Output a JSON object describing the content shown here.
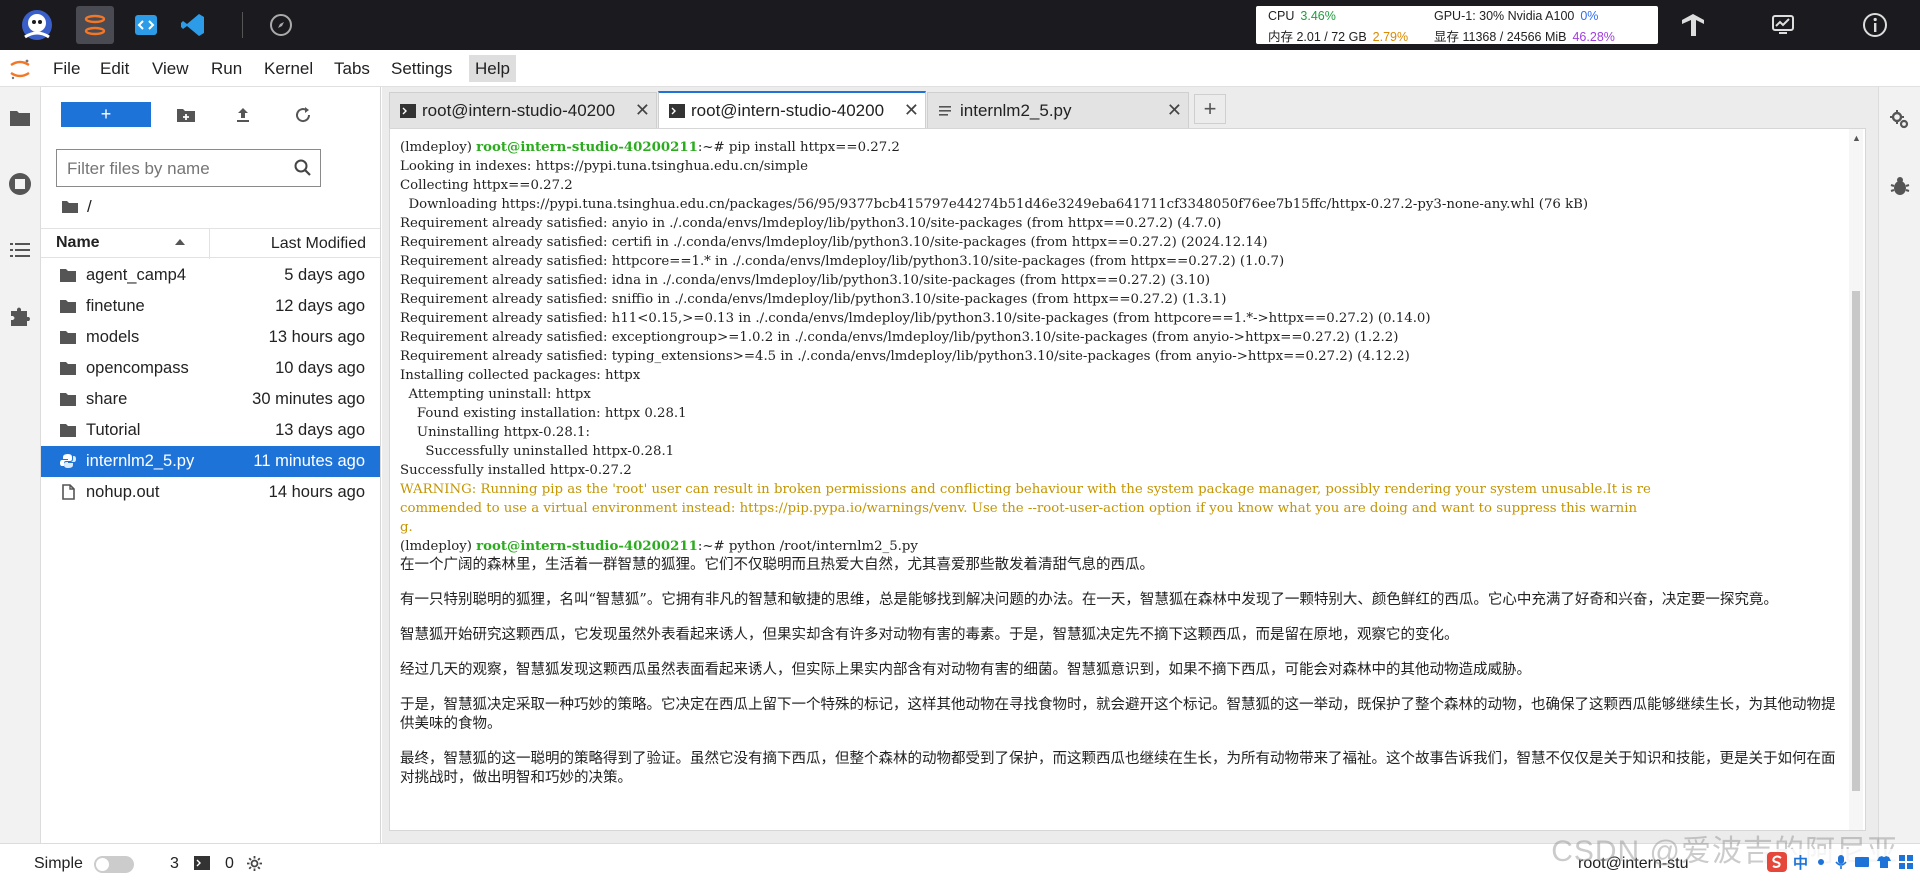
{
  "topbar": {
    "stats": {
      "cpu_label": "CPU",
      "cpu_value": "3.46%",
      "mem_label": "内存 2.01 / 72 GB",
      "mem_value": "2.79%",
      "gpu_label": "GPU-1: 30% Nvidia A100",
      "gpu_value": "0%",
      "vram_label": "显存 11368 / 24566 MiB",
      "vram_value": "46.28%"
    }
  },
  "menubar": {
    "items": [
      "File",
      "Edit",
      "View",
      "Run",
      "Kernel",
      "Tabs",
      "Settings",
      "Help"
    ],
    "active": "Help"
  },
  "filebrowser": {
    "new_button": "+",
    "filter_placeholder": "Filter files by name",
    "breadcrumb": "/",
    "columns": {
      "name": "Name",
      "modified": "Last Modified"
    },
    "files": [
      {
        "name": "agent_camp4",
        "modified": "5 days ago",
        "type": "folder"
      },
      {
        "name": "finetune",
        "modified": "12 days ago",
        "type": "folder"
      },
      {
        "name": "models",
        "modified": "13 hours ago",
        "type": "folder"
      },
      {
        "name": "opencompass",
        "modified": "10 days ago",
        "type": "folder"
      },
      {
        "name": "share",
        "modified": "30 minutes ago",
        "type": "folder"
      },
      {
        "name": "Tutorial",
        "modified": "13 days ago",
        "type": "folder"
      },
      {
        "name": "internlm2_5.py",
        "modified": "11 minutes ago",
        "type": "python",
        "selected": true
      },
      {
        "name": "nohup.out",
        "modified": "14 hours ago",
        "type": "file"
      }
    ]
  },
  "tabs": [
    {
      "label": "root@intern-studio-40200",
      "type": "terminal",
      "active": false
    },
    {
      "label": "root@intern-studio-40200",
      "type": "terminal",
      "active": true
    },
    {
      "label": "internlm2_5.py",
      "type": "file",
      "active": false
    }
  ],
  "terminal": {
    "env": "(lmdeploy)",
    "prompt_host": "root@intern-studio-40200211",
    "prompt_suffix": ":~# ",
    "cmd1": "pip install httpx==0.27.2",
    "lines1": [
      "Looking in indexes: https://pypi.tuna.tsinghua.edu.cn/simple",
      "Collecting httpx==0.27.2",
      "  Downloading https://pypi.tuna.tsinghua.edu.cn/packages/56/95/9377bcb415797e44274b51d46e3249eba641711cf3348050f76ee7b15ffc/httpx-0.27.2-py3-none-any.whl (76 kB)",
      "Requirement already satisfied: anyio in ./.conda/envs/lmdeploy/lib/python3.10/site-packages (from httpx==0.27.2) (4.7.0)",
      "Requirement already satisfied: certifi in ./.conda/envs/lmdeploy/lib/python3.10/site-packages (from httpx==0.27.2) (2024.12.14)",
      "Requirement already satisfied: httpcore==1.* in ./.conda/envs/lmdeploy/lib/python3.10/site-packages (from httpx==0.27.2) (1.0.7)",
      "Requirement already satisfied: idna in ./.conda/envs/lmdeploy/lib/python3.10/site-packages (from httpx==0.27.2) (3.10)",
      "Requirement already satisfied: sniffio in ./.conda/envs/lmdeploy/lib/python3.10/site-packages (from httpx==0.27.2) (1.3.1)",
      "Requirement already satisfied: h11<0.15,>=0.13 in ./.conda/envs/lmdeploy/lib/python3.10/site-packages (from httpcore==1.*->httpx==0.27.2) (0.14.0)",
      "Requirement already satisfied: exceptiongroup>=1.0.2 in ./.conda/envs/lmdeploy/lib/python3.10/site-packages (from anyio->httpx==0.27.2) (1.2.2)",
      "Requirement already satisfied: typing_extensions>=4.5 in ./.conda/envs/lmdeploy/lib/python3.10/site-packages (from anyio->httpx==0.27.2) (4.12.2)",
      "Installing collected packages: httpx",
      "  Attempting uninstall: httpx",
      "    Found existing installation: httpx 0.28.1",
      "    Uninstalling httpx-0.28.1:",
      "      Successfully uninstalled httpx-0.28.1",
      "Successfully installed httpx-0.27.2"
    ],
    "warning": "WARNING: Running pip as the 'root' user can result in broken permissions and conflicting behaviour with the system package manager, possibly rendering your system unusable.It is re\ncommended to use a virtual environment instead: https://pip.pypa.io/warnings/venv. Use the --root-user-action option if you know what you are doing and want to suppress this warnin\ng.",
    "cmd2": "python /root/internlm2_5.py",
    "story": [
      "在一个广阔的森林里，生活着一群智慧的狐狸。它们不仅聪明而且热爱大自然，尤其喜爱那些散发着清甜气息的西瓜。",
      "有一只特别聪明的狐狸，名叫“智慧狐”。它拥有非凡的智慧和敏捷的思维，总是能够找到解决问题的办法。在一天，智慧狐在森林中发现了一颗特别大、颜色鲜红的西瓜。它心中充满了好奇和兴奋，决定要一探究竟。",
      "智慧狐开始研究这颗西瓜，它发现虽然外表看起来诱人，但果实却含有许多对动物有害的毒素。于是，智慧狐决定先不摘下这颗西瓜，而是留在原地，观察它的变化。",
      "经过几天的观察，智慧狐发现这颗西瓜虽然表面看起来诱人，但实际上果实内部含有对动物有害的细菌。智慧狐意识到，如果不摘下西瓜，可能会对森林中的其他动物造成威胁。",
      "于是，智慧狐决定采取一种巧妙的策略。它决定在西瓜上留下一个特殊的标记，这样其他动物在寻找食物时，就会避开这个标记。智慧狐的这一举动，既保护了整个森林的动物，也确保了这颗西瓜能够继续生长，为其他动物提供美味的食物。",
      "最终，智慧狐的这一聪明的策略得到了验证。虽然它没有摘下西瓜，但整个森林的动物都受到了保护，而这颗西瓜也继续在生长，为所有动物带来了福祉。这个故事告诉我们，智慧不仅仅是关于知识和技能，更是关于如何在面对挑战时，做出明智和巧妙的决策。"
    ]
  },
  "statusbar": {
    "simple_label": "Simple",
    "count_a": "3",
    "count_b": "0",
    "host": "root@intern-stu",
    "watermark": "CSDN @爱波吉的阿尼亚",
    "ime": "中"
  }
}
